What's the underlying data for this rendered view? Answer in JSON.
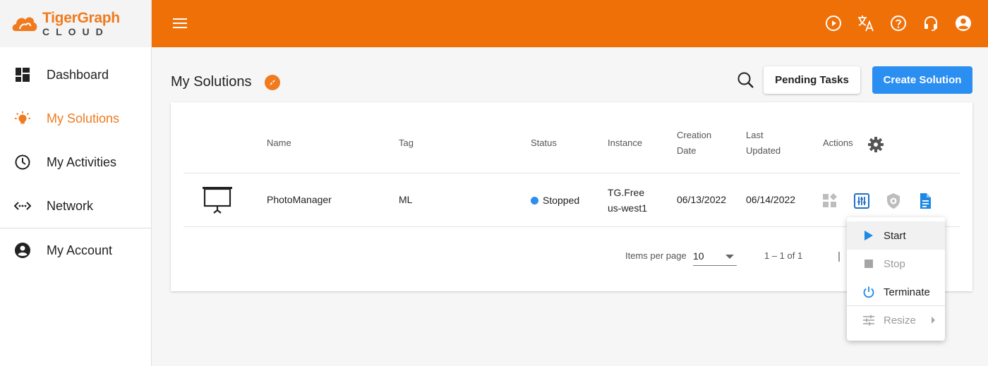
{
  "brand": {
    "line1": "TigerGraph",
    "line2": "CLOUD",
    "accent": "#f07008"
  },
  "sidebar": {
    "items": [
      {
        "label": "Dashboard",
        "icon": "dashboard-icon"
      },
      {
        "label": "My Solutions",
        "icon": "lightbulb-icon",
        "active": true
      },
      {
        "label": "My Activities",
        "icon": "clock-icon"
      },
      {
        "label": "Network",
        "icon": "network-icon"
      },
      {
        "label": "My Account",
        "icon": "account-circle-icon"
      }
    ]
  },
  "topbar": {
    "icons": [
      "play-circle-icon",
      "translate-icon",
      "help-icon",
      "headset-icon",
      "user-icon"
    ]
  },
  "main": {
    "title": "My Solutions",
    "pending_label": "Pending Tasks",
    "create_label": "Create Solution",
    "create_color": "#2b8ef1"
  },
  "table": {
    "headers": {
      "name": "Name",
      "tag": "Tag",
      "status": "Status",
      "instance": "Instance",
      "creation_1": "Creation",
      "creation_2": "Date",
      "updated_1": "Last",
      "updated_2": "Updated",
      "actions": "Actions"
    },
    "rows": [
      {
        "name": "PhotoManager",
        "tag": "ML",
        "status": "Stopped",
        "instance_1": "TG.Free",
        "instance_2": "us-west1",
        "created": "06/13/2022",
        "updated": "06/14/2022"
      }
    ]
  },
  "pagination": {
    "items_per_page_label": "Items per page",
    "page_size": "10",
    "range": "1 – 1 of 1"
  },
  "menu": {
    "items": [
      {
        "label": "Start",
        "icon": "play-icon",
        "enabled": true
      },
      {
        "label": "Stop",
        "icon": "stop-icon",
        "enabled": false
      },
      {
        "label": "Terminate",
        "icon": "power-icon",
        "enabled": true
      },
      {
        "label": "Resize",
        "icon": "tune-icon",
        "enabled": false
      }
    ]
  }
}
